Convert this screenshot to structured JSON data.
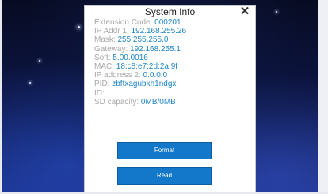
{
  "dialog": {
    "title": "System Info",
    "close_symbol": "✕",
    "rows": [
      {
        "label": "Extension Code:",
        "value": "000201"
      },
      {
        "label": "IP Addr 1:",
        "value": "192.168.255.26"
      },
      {
        "label": "Mask:",
        "value": "255.255.255.0"
      },
      {
        "label": "Gateway:",
        "value": "192.168.255.1"
      },
      {
        "label": "Soft:",
        "value": "5.00.0016"
      },
      {
        "label": "MAC:",
        "value": "18:c8:e7:2d:2a:9f"
      },
      {
        "label": "IP address 2:",
        "value": "0.0.0.0"
      },
      {
        "label": "PID:",
        "value": "zbftxagubkh1ndgx"
      },
      {
        "label": "ID:",
        "value": ""
      },
      {
        "label": "SD capacity:",
        "value": "0MB/0MB"
      }
    ],
    "buttons": {
      "format_label": "Format",
      "read_label": "Read"
    }
  },
  "colors": {
    "label": "#a8a8a8",
    "value": "#1f86c8",
    "button": "#1378c9"
  },
  "icons": {
    "close": "close-icon"
  }
}
